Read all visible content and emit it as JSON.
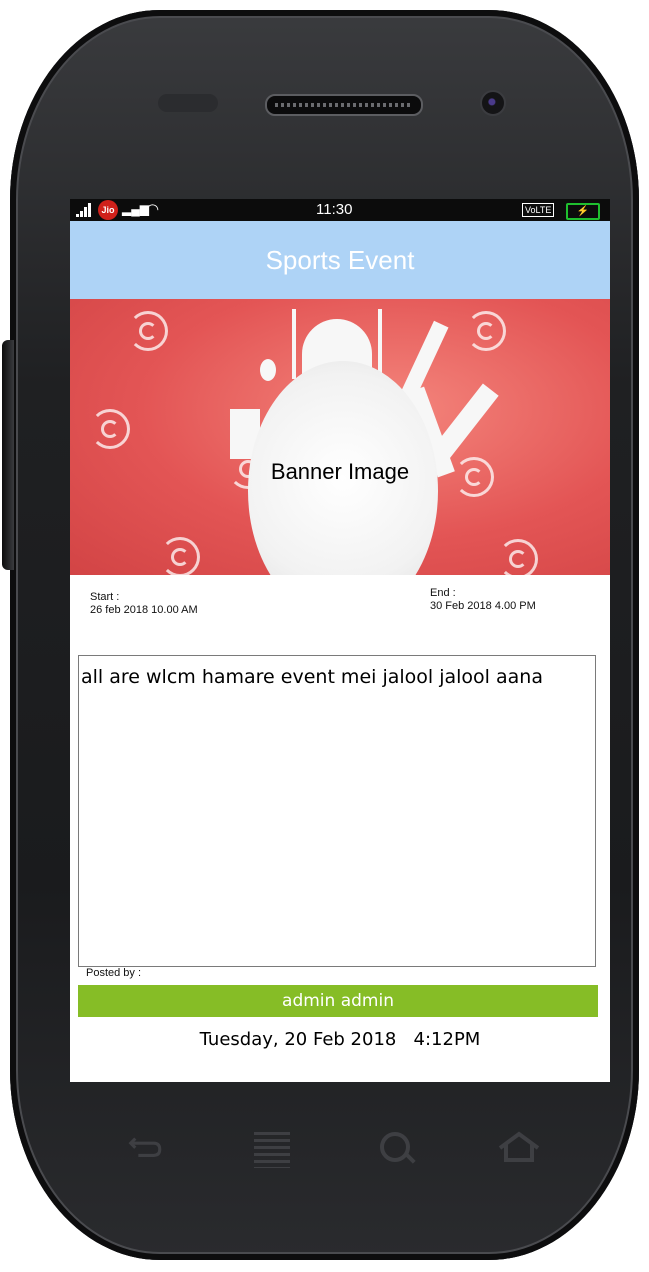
{
  "status_bar": {
    "carrier_badge": "Jio",
    "time": "11:30",
    "volte": "VoLTE",
    "battery_icon": "battery-charging-icon",
    "signal_icon": "signal-bars-icon",
    "wifi_icon": "wifi-icon"
  },
  "app_bar": {
    "title": "Sports Event"
  },
  "banner": {
    "label": "Banner Image"
  },
  "event": {
    "start_label": "Start :",
    "start_value": "26 feb 2018 10.00 AM",
    "end_label": "End :",
    "end_value": "30 Feb 2018 4.00 PM",
    "description": "all are wlcm hamare event mei jalool jalool aana"
  },
  "post": {
    "posted_by_label": "Posted by :",
    "author": "admin admin",
    "timestamp": "Tuesday, 20 Feb 2018   4:12PM"
  },
  "nav_keys": [
    "back-icon",
    "menu-icon",
    "search-icon",
    "home-icon"
  ],
  "colors": {
    "app_bar": "#aed3f6",
    "banner": "#e35555",
    "author_bar": "#86bd26"
  }
}
